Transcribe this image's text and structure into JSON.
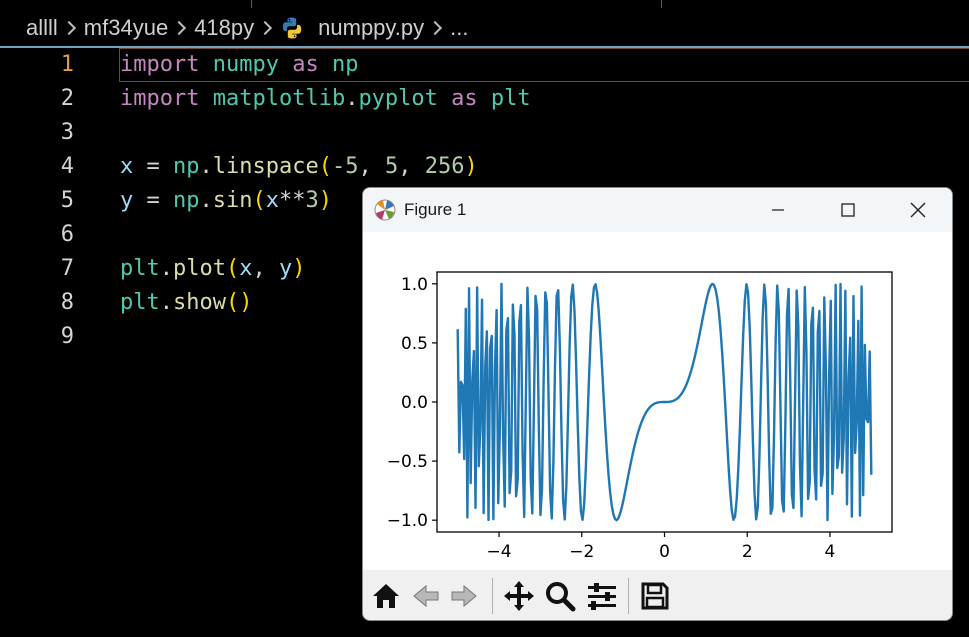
{
  "breadcrumb": {
    "items": [
      "allll",
      "mf34yue",
      "418py",
      "numppy.py",
      "..."
    ],
    "file_icon": "python-icon"
  },
  "editor": {
    "active_line": 1,
    "lines": [
      {
        "num": "1"
      },
      {
        "num": "2"
      },
      {
        "num": "3"
      },
      {
        "num": "4"
      },
      {
        "num": "5"
      },
      {
        "num": "6"
      },
      {
        "num": "7"
      },
      {
        "num": "8"
      },
      {
        "num": "9"
      }
    ],
    "code": {
      "l1": {
        "kw": "import",
        "mod": "numpy",
        "as": "as",
        "alias": "np"
      },
      "l2": {
        "kw": "import",
        "mod1": "matplotlib",
        "dot": ".",
        "mod2": "pyplot",
        "as": "as",
        "alias": "plt"
      },
      "l4": {
        "var": "x",
        "eq": " = ",
        "obj": "np",
        "dot": ".",
        "fn": "linspace",
        "open": "(",
        "a1": "-5",
        "c1": ", ",
        "a2": "5",
        "c2": ", ",
        "a3": "256",
        "close": ")"
      },
      "l5": {
        "var": "y",
        "eq": " = ",
        "obj": "np",
        "dot": ".",
        "fn": "sin",
        "open": "(",
        "arg": "x",
        "op": "**",
        "num": "3",
        "close": ")"
      },
      "l7": {
        "obj": "plt",
        "dot": ".",
        "fn": "plot",
        "open": "(",
        "a1": "x",
        "c": ", ",
        "a2": "y",
        "close": ")"
      },
      "l8": {
        "obj": "plt",
        "dot": ".",
        "fn": "show",
        "parens": "()"
      }
    }
  },
  "figure_window": {
    "title": "Figure 1",
    "controls": [
      "minimize-icon",
      "maximize-icon",
      "close-icon"
    ],
    "toolbar": [
      "home-icon",
      "back-arrow-icon",
      "forward-arrow-icon",
      "pan-icon",
      "zoom-icon",
      "configure-subplots-icon",
      "save-icon"
    ]
  },
  "chart_data": {
    "type": "line",
    "function": "y = sin(x**3)",
    "x_range": [
      -5,
      5
    ],
    "n_points": 256,
    "xlim": [
      -5.5,
      5.5
    ],
    "ylim": [
      -1.1,
      1.1
    ],
    "xticks": [
      "−4",
      "−2",
      "0",
      "2",
      "4"
    ],
    "yticks": [
      "1.0",
      "0.5",
      "0.0",
      "−0.5",
      "−1.0"
    ],
    "line_color": "#1f77b4",
    "grid": false
  }
}
